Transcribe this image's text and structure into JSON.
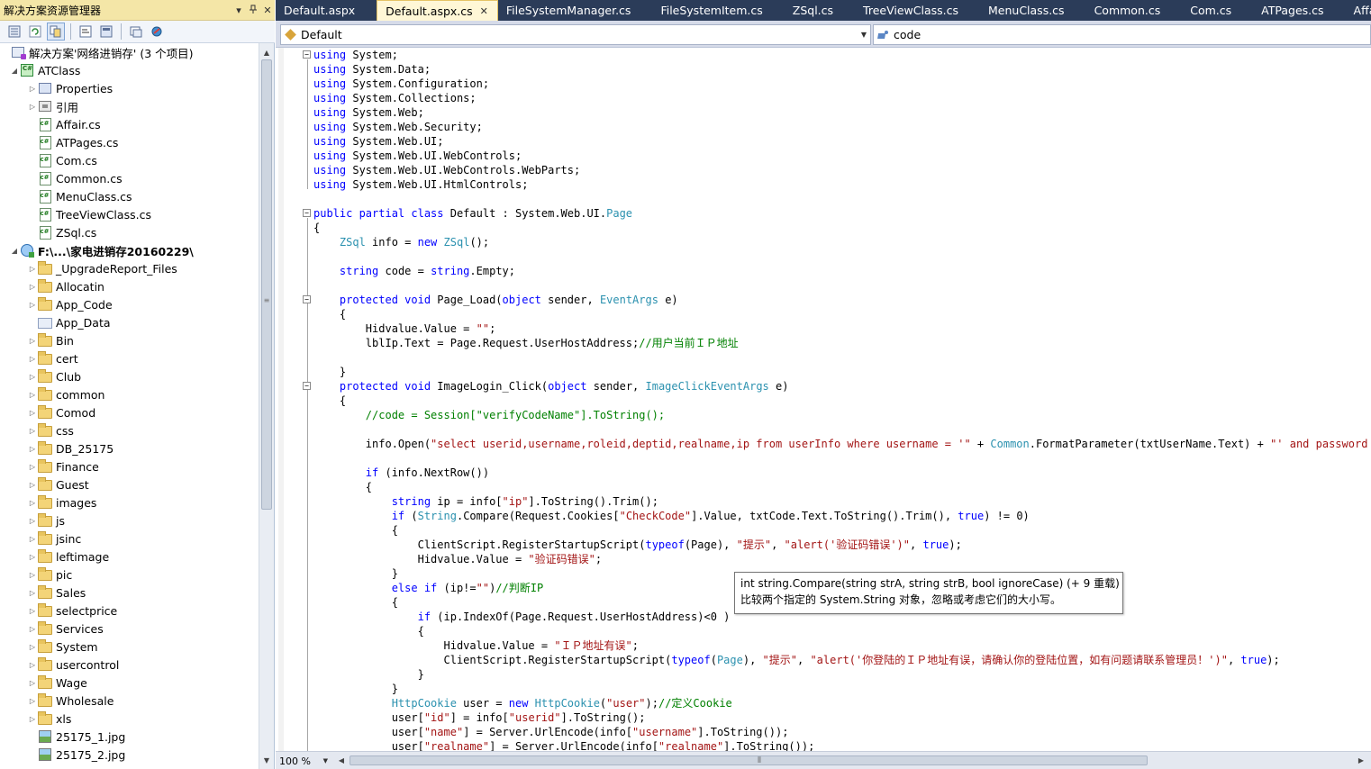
{
  "solution_explorer": {
    "title": "解决方案资源管理器",
    "title_buttons": [
      "▾",
      "📌",
      "✕"
    ],
    "tree": [
      {
        "label": "解决方案'网络进销存' (3 个项目)",
        "icon": "solution-icon",
        "level": 0,
        "arrow": "",
        "bold": false
      },
      {
        "label": "ATClass",
        "icon": "csharp-project-icon",
        "level": 0,
        "arrow": "◢",
        "bold": false
      },
      {
        "label": "Properties",
        "icon": "properties-icon",
        "level": 1,
        "arrow": "▷",
        "bold": false
      },
      {
        "label": "引用",
        "icon": "references-icon",
        "level": 1,
        "arrow": "▷",
        "bold": false
      },
      {
        "label": "Affair.cs",
        "icon": "cs-file-icon",
        "level": 1,
        "arrow": "",
        "bold": false
      },
      {
        "label": "ATPages.cs",
        "icon": "cs-file-icon",
        "level": 1,
        "arrow": "",
        "bold": false
      },
      {
        "label": "Com.cs",
        "icon": "cs-file-icon",
        "level": 1,
        "arrow": "",
        "bold": false
      },
      {
        "label": "Common.cs",
        "icon": "cs-file-icon",
        "level": 1,
        "arrow": "",
        "bold": false
      },
      {
        "label": "MenuClass.cs",
        "icon": "cs-file-icon",
        "level": 1,
        "arrow": "",
        "bold": false
      },
      {
        "label": "TreeViewClass.cs",
        "icon": "cs-file-icon",
        "level": 1,
        "arrow": "",
        "bold": false
      },
      {
        "label": "ZSql.cs",
        "icon": "cs-file-icon",
        "level": 1,
        "arrow": "",
        "bold": false
      },
      {
        "label": "F:\\...\\家电进销存20160229\\",
        "icon": "website-project-icon",
        "level": 0,
        "arrow": "◢",
        "bold": true
      },
      {
        "label": "_UpgradeReport_Files",
        "icon": "folder-icon",
        "level": 1,
        "arrow": "▷",
        "bold": false
      },
      {
        "label": "Allocatin",
        "icon": "folder-icon",
        "level": 1,
        "arrow": "▷",
        "bold": false
      },
      {
        "label": "App_Code",
        "icon": "folder-icon",
        "level": 1,
        "arrow": "▷",
        "bold": false
      },
      {
        "label": "App_Data",
        "icon": "special-folder-icon",
        "level": 1,
        "arrow": "",
        "bold": false
      },
      {
        "label": "Bin",
        "icon": "folder-icon",
        "level": 1,
        "arrow": "▷",
        "bold": false
      },
      {
        "label": "cert",
        "icon": "folder-icon",
        "level": 1,
        "arrow": "▷",
        "bold": false
      },
      {
        "label": "Club",
        "icon": "folder-icon",
        "level": 1,
        "arrow": "▷",
        "bold": false
      },
      {
        "label": "common",
        "icon": "folder-icon",
        "level": 1,
        "arrow": "▷",
        "bold": false
      },
      {
        "label": "Comod",
        "icon": "folder-icon",
        "level": 1,
        "arrow": "▷",
        "bold": false
      },
      {
        "label": "css",
        "icon": "folder-icon",
        "level": 1,
        "arrow": "▷",
        "bold": false
      },
      {
        "label": "DB_25175",
        "icon": "folder-icon",
        "level": 1,
        "arrow": "▷",
        "bold": false
      },
      {
        "label": "Finance",
        "icon": "folder-icon",
        "level": 1,
        "arrow": "▷",
        "bold": false
      },
      {
        "label": "Guest",
        "icon": "folder-icon",
        "level": 1,
        "arrow": "▷",
        "bold": false
      },
      {
        "label": "images",
        "icon": "folder-icon",
        "level": 1,
        "arrow": "▷",
        "bold": false
      },
      {
        "label": "js",
        "icon": "folder-icon",
        "level": 1,
        "arrow": "▷",
        "bold": false
      },
      {
        "label": "jsinc",
        "icon": "folder-icon",
        "level": 1,
        "arrow": "▷",
        "bold": false
      },
      {
        "label": "leftimage",
        "icon": "folder-icon",
        "level": 1,
        "arrow": "▷",
        "bold": false
      },
      {
        "label": "pic",
        "icon": "folder-icon",
        "level": 1,
        "arrow": "▷",
        "bold": false
      },
      {
        "label": "Sales",
        "icon": "folder-icon",
        "level": 1,
        "arrow": "▷",
        "bold": false
      },
      {
        "label": "selectprice",
        "icon": "folder-icon",
        "level": 1,
        "arrow": "▷",
        "bold": false
      },
      {
        "label": "Services",
        "icon": "folder-icon",
        "level": 1,
        "arrow": "▷",
        "bold": false
      },
      {
        "label": "System",
        "icon": "folder-icon",
        "level": 1,
        "arrow": "▷",
        "bold": false
      },
      {
        "label": "usercontrol",
        "icon": "folder-icon",
        "level": 1,
        "arrow": "▷",
        "bold": false
      },
      {
        "label": "Wage",
        "icon": "folder-icon",
        "level": 1,
        "arrow": "▷",
        "bold": false
      },
      {
        "label": "Wholesale",
        "icon": "folder-icon",
        "level": 1,
        "arrow": "▷",
        "bold": false
      },
      {
        "label": "xls",
        "icon": "folder-icon",
        "level": 1,
        "arrow": "▷",
        "bold": false
      },
      {
        "label": "25175_1.jpg",
        "icon": "image-file-icon",
        "level": 1,
        "arrow": "",
        "bold": false
      },
      {
        "label": "25175_2.jpg",
        "icon": "image-file-icon",
        "level": 1,
        "arrow": "",
        "bold": false
      }
    ]
  },
  "tabs": [
    {
      "label": "Default.aspx",
      "active": false
    },
    {
      "label": "Default.aspx.cs",
      "active": true
    },
    {
      "label": "FileSystemManager.cs",
      "active": false
    },
    {
      "label": "FileSystemItem.cs",
      "active": false
    },
    {
      "label": "ZSql.cs",
      "active": false
    },
    {
      "label": "TreeViewClass.cs",
      "active": false
    },
    {
      "label": "MenuClass.cs",
      "active": false
    },
    {
      "label": "Common.cs",
      "active": false
    },
    {
      "label": "Com.cs",
      "active": false
    },
    {
      "label": "ATPages.cs",
      "active": false
    },
    {
      "label": "Affair.cs",
      "active": false
    }
  ],
  "tab_close_glyph": "✕",
  "navbar": {
    "type_selector": "Default",
    "member_selector": "code"
  },
  "code_lines": [
    [
      [
        "kw",
        "using"
      ],
      [
        "tx",
        " System;"
      ]
    ],
    [
      [
        "kw",
        "using"
      ],
      [
        "tx",
        " System.Data;"
      ]
    ],
    [
      [
        "kw",
        "using"
      ],
      [
        "tx",
        " System.Configuration;"
      ]
    ],
    [
      [
        "kw",
        "using"
      ],
      [
        "tx",
        " System.Collections;"
      ]
    ],
    [
      [
        "kw",
        "using"
      ],
      [
        "tx",
        " System.Web;"
      ]
    ],
    [
      [
        "kw",
        "using"
      ],
      [
        "tx",
        " System.Web.Security;"
      ]
    ],
    [
      [
        "kw",
        "using"
      ],
      [
        "tx",
        " System.Web.UI;"
      ]
    ],
    [
      [
        "kw",
        "using"
      ],
      [
        "tx",
        " System.Web.UI.WebControls;"
      ]
    ],
    [
      [
        "kw",
        "using"
      ],
      [
        "tx",
        " System.Web.UI.WebControls.WebParts;"
      ]
    ],
    [
      [
        "kw",
        "using"
      ],
      [
        "tx",
        " System.Web.UI.HtmlControls;"
      ]
    ],
    [],
    [
      [
        "kw",
        "public partial class"
      ],
      [
        "tx",
        " Default : System.Web.UI."
      ],
      [
        "ty",
        "Page"
      ]
    ],
    [
      [
        "tx",
        "{"
      ]
    ],
    [
      [
        "tx",
        "    "
      ],
      [
        "ty",
        "ZSql"
      ],
      [
        "tx",
        " info = "
      ],
      [
        "kw",
        "new"
      ],
      [
        "tx",
        " "
      ],
      [
        "ty",
        "ZSql"
      ],
      [
        "tx",
        "();"
      ]
    ],
    [],
    [
      [
        "tx",
        "    "
      ],
      [
        "kw",
        "string"
      ],
      [
        "tx",
        " code = "
      ],
      [
        "kw",
        "string"
      ],
      [
        "tx",
        ".Empty;"
      ]
    ],
    [],
    [
      [
        "tx",
        "    "
      ],
      [
        "kw",
        "protected void"
      ],
      [
        "tx",
        " Page_Load("
      ],
      [
        "kw",
        "object"
      ],
      [
        "tx",
        " sender, "
      ],
      [
        "ty",
        "EventArgs"
      ],
      [
        "tx",
        " e)"
      ]
    ],
    [
      [
        "tx",
        "    {"
      ]
    ],
    [
      [
        "tx",
        "        Hidvalue.Value = "
      ],
      [
        "st",
        "\"\""
      ],
      [
        "tx",
        ";"
      ]
    ],
    [
      [
        "tx",
        "        lblIp.Text = Page.Request.UserHostAddress;"
      ],
      [
        "cm",
        "//用户当前ＩＰ地址"
      ]
    ],
    [],
    [
      [
        "tx",
        "    }"
      ]
    ],
    [
      [
        "tx",
        "    "
      ],
      [
        "kw",
        "protected void"
      ],
      [
        "tx",
        " ImageLogin_Click("
      ],
      [
        "kw",
        "object"
      ],
      [
        "tx",
        " sender, "
      ],
      [
        "ty",
        "ImageClickEventArgs"
      ],
      [
        "tx",
        " e)"
      ]
    ],
    [
      [
        "tx",
        "    {"
      ]
    ],
    [
      [
        "tx",
        "        "
      ],
      [
        "cm",
        "//code = Session[\"verifyCodeName\"].ToString();"
      ]
    ],
    [],
    [
      [
        "tx",
        "        info.Open("
      ],
      [
        "st",
        "\"select userid,username,roleid,deptid,realname,ip from userInfo where username = '\""
      ],
      [
        "tx",
        " + "
      ],
      [
        "ty",
        "Common"
      ],
      [
        "tx",
        ".FormatParameter(txtUserName.Text) + "
      ],
      [
        "st",
        "\"' and password = '\""
      ]
    ],
    [],
    [
      [
        "tx",
        "        "
      ],
      [
        "kw",
        "if"
      ],
      [
        "tx",
        " (info.NextRow())"
      ]
    ],
    [
      [
        "tx",
        "        {"
      ]
    ],
    [
      [
        "tx",
        "            "
      ],
      [
        "kw",
        "string"
      ],
      [
        "tx",
        " ip = info["
      ],
      [
        "st",
        "\"ip\""
      ],
      [
        "tx",
        "].ToString().Trim();"
      ]
    ],
    [
      [
        "tx",
        "            "
      ],
      [
        "kw",
        "if"
      ],
      [
        "tx",
        " ("
      ],
      [
        "ty",
        "String"
      ],
      [
        "tx",
        ".Compare(Request.Cookies["
      ],
      [
        "st",
        "\"CheckCode\""
      ],
      [
        "tx",
        "].Value, txtCode.Text.ToString().Trim(), "
      ],
      [
        "kw",
        "true"
      ],
      [
        "tx",
        ") != 0)"
      ]
    ],
    [
      [
        "tx",
        "            {"
      ]
    ],
    [
      [
        "tx",
        "                ClientScript.RegisterStartupScript("
      ],
      [
        "kw",
        "typeof"
      ],
      [
        "tx",
        "(Page), "
      ],
      [
        "st",
        "\"提示\""
      ],
      [
        "tx",
        ", "
      ],
      [
        "st",
        "\"alert('验证码错误')\""
      ],
      [
        "tx",
        ", "
      ],
      [
        "kw",
        "true"
      ],
      [
        "tx",
        ");"
      ]
    ],
    [
      [
        "tx",
        "                Hidvalue.Value = "
      ],
      [
        "st",
        "\"验证码错误\""
      ],
      [
        "tx",
        ";"
      ]
    ],
    [
      [
        "tx",
        "            }"
      ]
    ],
    [
      [
        "tx",
        "            "
      ],
      [
        "kw",
        "else if"
      ],
      [
        "tx",
        " (ip!="
      ],
      [
        "st",
        "\"\""
      ],
      [
        "tx",
        ")"
      ],
      [
        "cm",
        "//判断IP"
      ]
    ],
    [
      [
        "tx",
        "            {"
      ]
    ],
    [
      [
        "tx",
        "                "
      ],
      [
        "kw",
        "if"
      ],
      [
        "tx",
        " (ip.IndexOf(Page.Request.UserHostAddress)<0 )"
      ]
    ],
    [
      [
        "tx",
        "                {"
      ]
    ],
    [
      [
        "tx",
        "                    Hidvalue.Value = "
      ],
      [
        "st",
        "\"ＩＰ地址有误\""
      ],
      [
        "tx",
        ";"
      ]
    ],
    [
      [
        "tx",
        "                    ClientScript.RegisterStartupScript("
      ],
      [
        "kw",
        "typeof"
      ],
      [
        "tx",
        "("
      ],
      [
        "ty",
        "Page"
      ],
      [
        "tx",
        "), "
      ],
      [
        "st",
        "\"提示\""
      ],
      [
        "tx",
        ", "
      ],
      [
        "st",
        "\"alert('你登陆的ＩＰ地址有误，请确认你的登陆位置，如有问题请联系管理员！')\""
      ],
      [
        "tx",
        ", "
      ],
      [
        "kw",
        "true"
      ],
      [
        "tx",
        ");"
      ]
    ],
    [
      [
        "tx",
        "                }"
      ]
    ],
    [
      [
        "tx",
        "            }"
      ]
    ],
    [
      [
        "tx",
        "            "
      ],
      [
        "ty",
        "HttpCookie"
      ],
      [
        "tx",
        " user = "
      ],
      [
        "kw",
        "new"
      ],
      [
        "tx",
        " "
      ],
      [
        "ty",
        "HttpCookie"
      ],
      [
        "tx",
        "("
      ],
      [
        "st",
        "\"user\""
      ],
      [
        "tx",
        ");"
      ],
      [
        "cm",
        "//定义Cookie"
      ]
    ],
    [
      [
        "tx",
        "            user["
      ],
      [
        "st",
        "\"id\""
      ],
      [
        "tx",
        "] = info["
      ],
      [
        "st",
        "\"userid\""
      ],
      [
        "tx",
        "].ToString();"
      ]
    ],
    [
      [
        "tx",
        "            user["
      ],
      [
        "st",
        "\"name\""
      ],
      [
        "tx",
        "] = Server.UrlEncode(info["
      ],
      [
        "st",
        "\"username\""
      ],
      [
        "tx",
        "].ToString());"
      ]
    ],
    [
      [
        "tx",
        "            user["
      ],
      [
        "st",
        "\"realname\""
      ],
      [
        "tx",
        "] = Server.UrlEncode(info["
      ],
      [
        "st",
        "\"realname\""
      ],
      [
        "tx",
        "].ToString());"
      ]
    ]
  ],
  "tooltip": {
    "signature": "int string.Compare(string strA, string strB, bool ignoreCase)  (+ 9 重载)",
    "description": "比较两个指定的 System.String 对象，忽略或考虑它们的大小写。"
  },
  "statusbar": {
    "zoom": "100 %"
  }
}
